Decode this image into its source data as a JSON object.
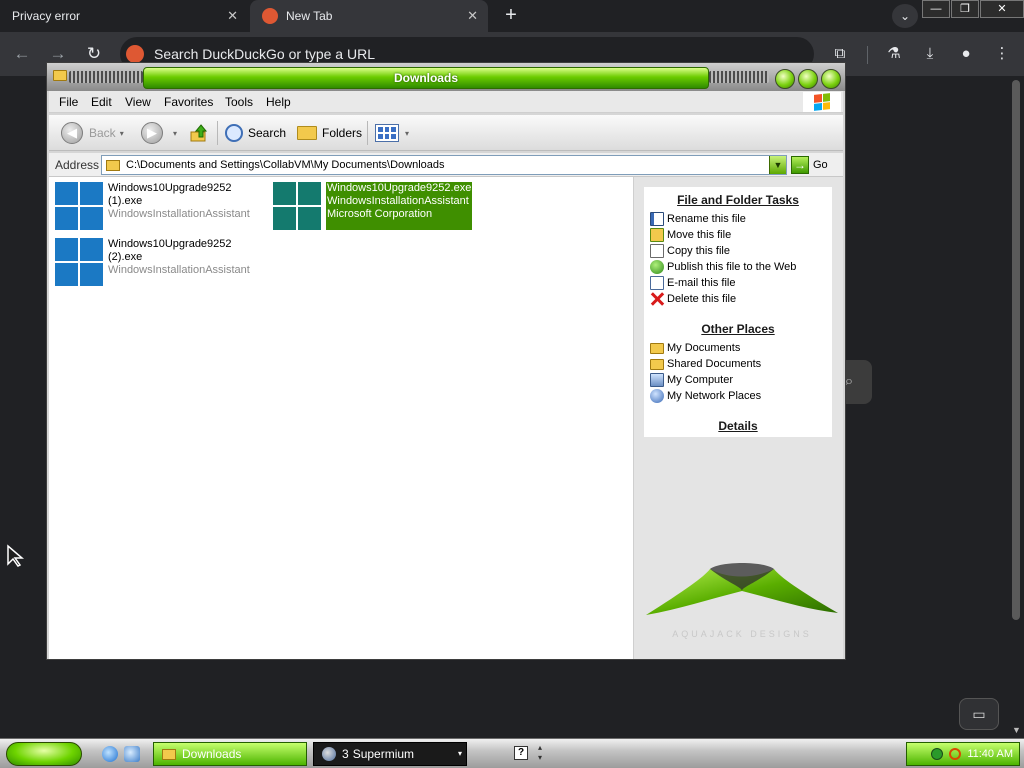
{
  "browser": {
    "tabs": [
      {
        "title": "Privacy error",
        "active": false
      },
      {
        "title": "New Tab",
        "active": true
      }
    ],
    "omnibox_placeholder": "Search DuckDuckGo or type a URL",
    "icons": {
      "back": "←",
      "forward": "→",
      "reload": "↻",
      "close": "✕",
      "new_tab": "+",
      "tab_search": "⌄",
      "minimize": "—",
      "restore": "❐",
      "win_close": "✕",
      "extensions": "⧉",
      "labs": "⚗",
      "download": "⤓",
      "profile": "●",
      "menu": "⋮",
      "bg_search": "⌕",
      "feedback": "▭"
    }
  },
  "explorer": {
    "title": "Downloads",
    "menu": [
      "File",
      "Edit",
      "View",
      "Favorites",
      "Tools",
      "Help"
    ],
    "toolbar": {
      "back": "Back",
      "search": "Search",
      "folders": "Folders",
      "arrow_back": "◀",
      "arrow_forward": "▶",
      "caret": "▾"
    },
    "address": {
      "label": "Address",
      "path": "C:\\Documents and Settings\\CollabVM\\My Documents\\Downloads",
      "go": "Go",
      "go_arrow": "→",
      "dropdown": "▼"
    },
    "files": [
      {
        "name_line1": "Windows10Upgrade9252",
        "name_line2": "(1).exe",
        "company": "WindowsInstallationAssistant",
        "selected": false
      },
      {
        "name_line1": "Windows10Upgrade9252.exe",
        "name_line2": "WindowsInstallationAssistant",
        "company": "Microsoft Corporation",
        "selected": true
      },
      {
        "name_line1": "Windows10Upgrade9252",
        "name_line2": "(2).exe",
        "company": "WindowsInstallationAssistant",
        "selected": false
      }
    ],
    "tasks": {
      "file_folder_heading": "File and Folder Tasks",
      "file_folder_items": [
        "Rename this file",
        "Move this file",
        "Copy this file",
        "Publish this file to the Web",
        "E-mail this file",
        "Delete this file"
      ],
      "other_places_heading": "Other Places",
      "other_places_items": [
        "My Documents",
        "Shared Documents",
        "My Computer",
        "My Network Places"
      ],
      "details_heading": "Details"
    },
    "branding": "AQUAJACK DESIGNS"
  },
  "taskbar": {
    "downloads_label": "Downloads",
    "supermium_count": "3",
    "supermium_label": "Supermium",
    "help": "?",
    "clock": "11:40 AM"
  },
  "colors": {
    "accent_green": "#6ccc00",
    "selection_green": "#3f8f00",
    "windows_blue": "#1b79c4"
  }
}
